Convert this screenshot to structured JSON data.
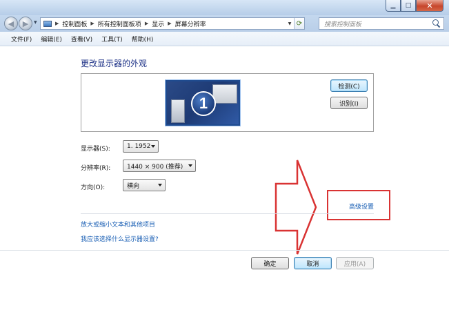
{
  "window": {
    "minimize_glyph": "▁",
    "maximize_glyph": "□",
    "close_glyph": "✕"
  },
  "nav": {
    "back_glyph": "◀",
    "forward_glyph": "▶",
    "breadcrumbs": [
      "控制面板",
      "所有控制面板项",
      "显示",
      "屏幕分辨率"
    ],
    "search_placeholder": "搜索控制面板"
  },
  "menu": [
    "文件(F)",
    "编辑(E)",
    "查看(V)",
    "工具(T)",
    "帮助(H)"
  ],
  "main": {
    "title": "更改显示器的外观",
    "monitor_number": "1",
    "detect_button": "检测(C)",
    "identify_button": "识别(I)",
    "fields": {
      "display_label": "显示器(S):",
      "display_value": "1. 1952",
      "resolution_label": "分辨率(R):",
      "resolution_value": "1440 × 900 (推荐)",
      "orientation_label": "方向(O):",
      "orientation_value": "横向"
    },
    "advanced_link": "高级设置",
    "links": [
      "放大或缩小文本和其他项目",
      "我应该选择什么显示器设置?"
    ]
  },
  "footer": {
    "ok_button": "确定",
    "cancel_button": "取消",
    "apply_button": "应用(A)"
  },
  "annotation": {
    "color": "#d93333"
  }
}
